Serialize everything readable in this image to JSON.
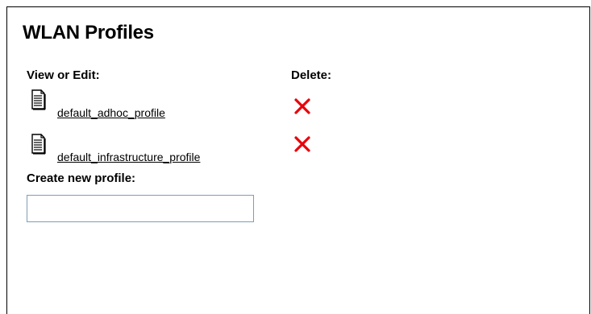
{
  "page": {
    "title": "WLAN Profiles"
  },
  "columns": {
    "view_edit": "View or Edit:",
    "delete": "Delete:"
  },
  "profiles": [
    {
      "name": "default_adhoc_profile",
      "icon": "document-icon",
      "delete_icon": "delete-x-icon"
    },
    {
      "name": "default_infrastructure_profile",
      "icon": "document-icon",
      "delete_icon": "delete-x-icon"
    }
  ],
  "create": {
    "label": "Create new profile:",
    "value": "",
    "placeholder": ""
  },
  "colors": {
    "delete": "#e8000b",
    "input_border": "#7f9db9",
    "frame_border": "#000000"
  }
}
